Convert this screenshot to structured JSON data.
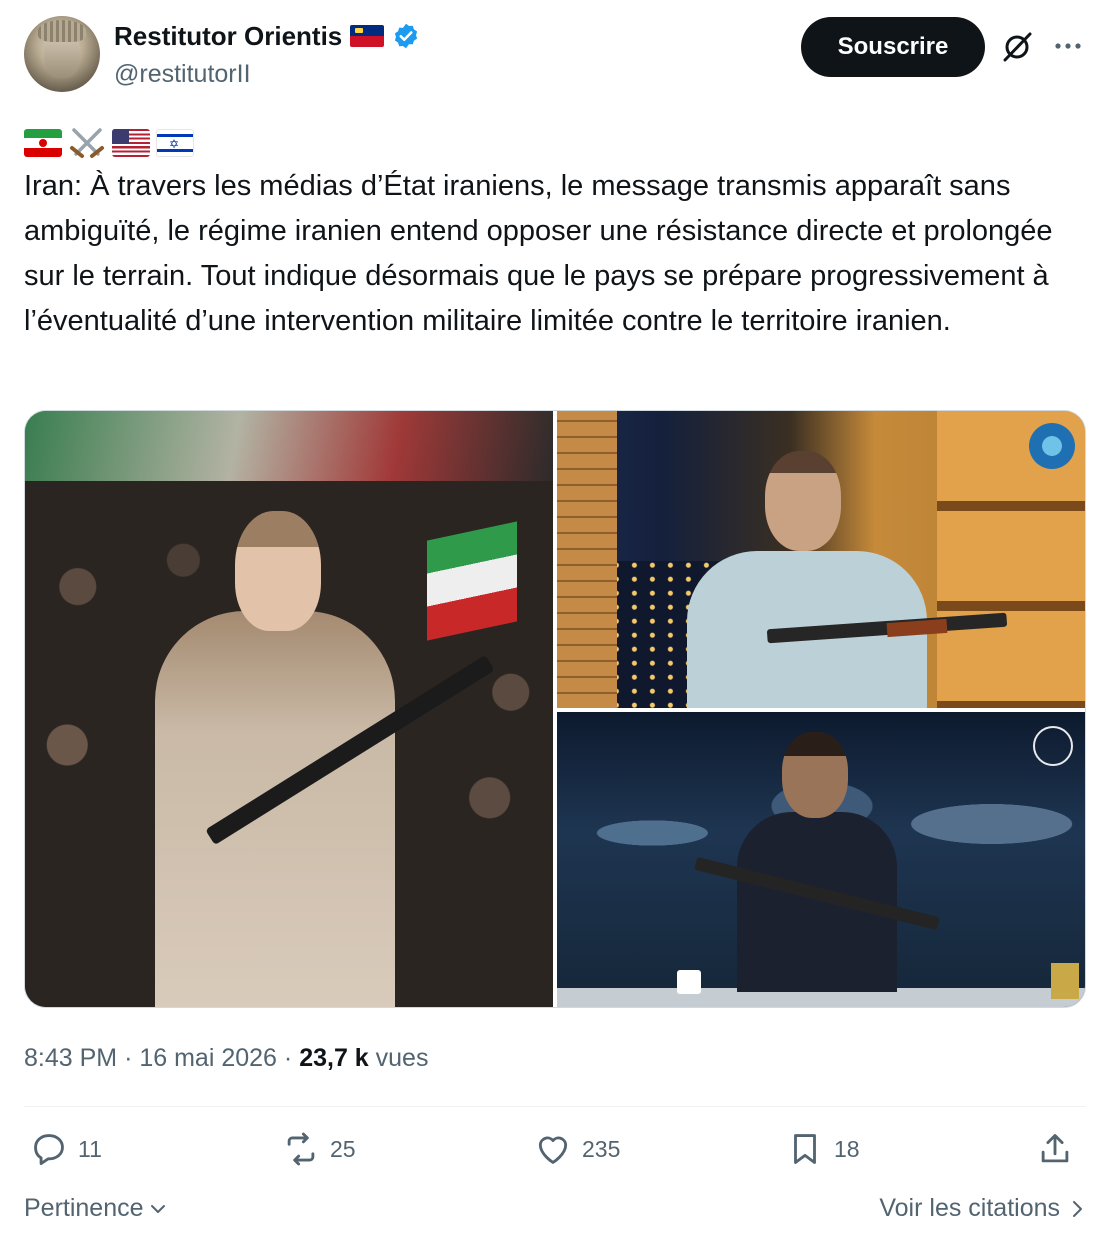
{
  "author": {
    "display_name": "Restitutor Orientis",
    "handle": "@restitutorII"
  },
  "header": {
    "subscribe_label": "Souscrire",
    "icons": [
      "liechtenstein-flag-icon",
      "verified-badge-icon",
      "grok-icon",
      "more-icon"
    ]
  },
  "tweet": {
    "emoji_icons": [
      "iran-flag-icon",
      "crossed-swords-icon",
      "usa-flag-icon",
      "israel-flag-icon"
    ],
    "text": "Iran: À travers les médias d’État iraniens, le message transmis apparaît sans ambiguïté, le régime iranien entend opposer une résistance directe et prolongée sur le terrain. Tout indique désormais que le pays se prépare progressivement à l’éventualité d’une intervention militaire limitée contre le territoire iranien."
  },
  "meta": {
    "time": "8:43 PM",
    "separator": "·",
    "date": "16 mai 2026",
    "views_count": "23,7 k",
    "views_label": "vues"
  },
  "actions": {
    "replies": "11",
    "reposts": "25",
    "likes": "235",
    "bookmarks": "18"
  },
  "footer": {
    "sort_label": "Pertinence",
    "quotes_label": "Voir les citations"
  },
  "colors": {
    "text": "#0f1419",
    "secondary": "#536471",
    "verified": "#1d9bf0",
    "button_bg": "#0f1419"
  }
}
